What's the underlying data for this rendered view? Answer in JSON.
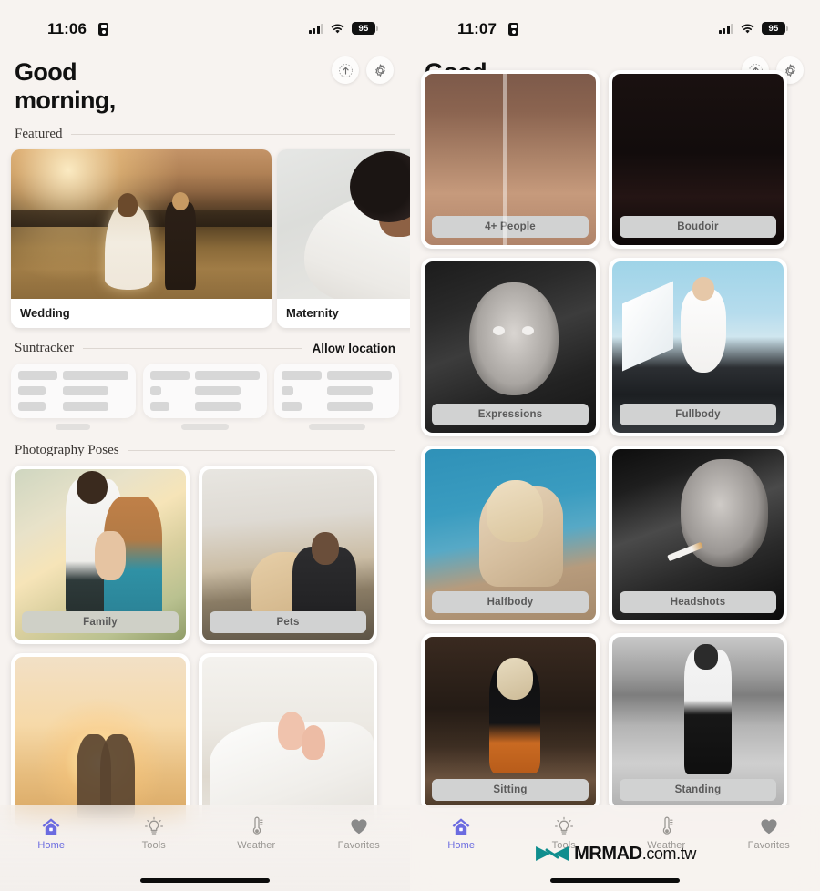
{
  "app": {
    "accent_purple": "#6b6be0",
    "bg": "#f7f3f0",
    "chip_bg": "#cfd0c7"
  },
  "left_panel": {
    "status_bar": {
      "time": "11:06",
      "recording_icon": "recording-indicator-icon",
      "signal_icon": "cellular-signal-icon",
      "wifi_icon": "wifi-icon",
      "battery_level": "95"
    },
    "header": {
      "greeting": "Good\nmorning,",
      "share_icon": "upload-arrow-icon",
      "settings_icon": "gear-icon"
    },
    "featured": {
      "title": "Featured",
      "cards": [
        {
          "label": "Wedding"
        },
        {
          "label": "Maternity"
        }
      ]
    },
    "suntracker": {
      "title": "Suntracker",
      "action": "Allow location",
      "placeholder_cards": 3
    },
    "poses": {
      "title": "Photography Poses",
      "items": [
        {
          "label": "Family"
        },
        {
          "label": "Pets"
        },
        {
          "label": ""
        },
        {
          "label": ""
        }
      ]
    },
    "tabbar": [
      {
        "label": "Home",
        "icon": "home-icon",
        "active": true
      },
      {
        "label": "Tools",
        "icon": "lightbulb-icon",
        "active": false
      },
      {
        "label": "Weather",
        "icon": "thermometer-icon",
        "active": false
      },
      {
        "label": "Favorites",
        "icon": "heart-icon",
        "active": false
      }
    ]
  },
  "right_panel": {
    "status_bar": {
      "time": "11:07",
      "recording_icon": "recording-indicator-icon",
      "signal_icon": "cellular-signal-icon",
      "wifi_icon": "wifi-icon",
      "battery_level": "95"
    },
    "header": {
      "greeting": "Good\nmorning,",
      "share_icon": "upload-arrow-icon",
      "settings_icon": "gear-icon"
    },
    "poses": {
      "items": [
        {
          "label": "4+ People"
        },
        {
          "label": "Boudoir"
        },
        {
          "label": "Expressions"
        },
        {
          "label": "Fullbody"
        },
        {
          "label": "Halfbody"
        },
        {
          "label": "Headshots"
        },
        {
          "label": "Sitting"
        },
        {
          "label": "Standing"
        }
      ]
    },
    "tabbar": [
      {
        "label": "Home",
        "icon": "home-icon",
        "active": true
      },
      {
        "label": "Tools",
        "icon": "lightbulb-icon",
        "active": false
      },
      {
        "label": "Weather",
        "icon": "thermometer-icon",
        "active": false
      },
      {
        "label": "Favorites",
        "icon": "heart-icon",
        "active": false
      }
    ]
  },
  "watermark": {
    "brand": "MRMAD",
    "suffix": ".com.tw",
    "logo_icon": "mrmad-bowtie-logo-icon",
    "logo_color": "#0f8e8e"
  }
}
